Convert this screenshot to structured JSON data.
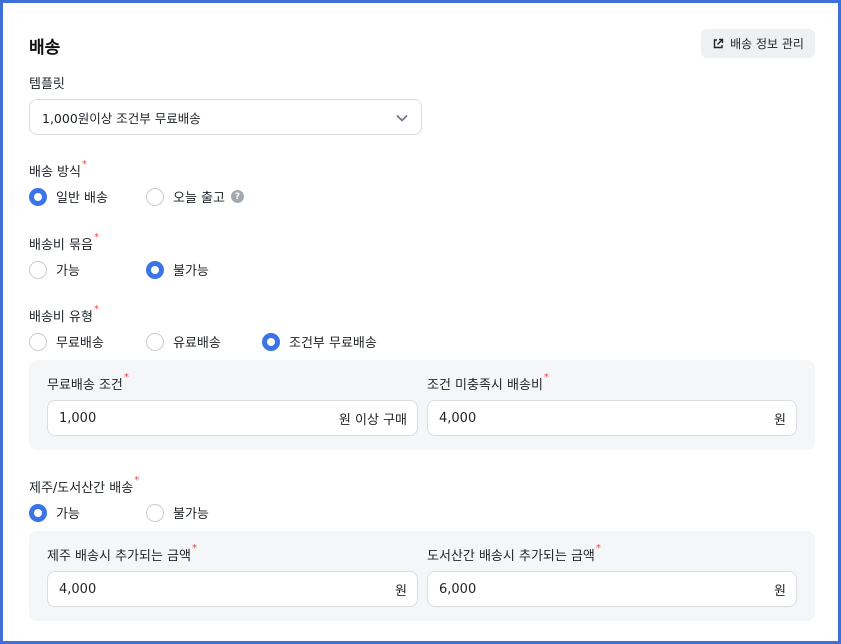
{
  "section": {
    "title": "배송",
    "manage_button_label": "배송 정보 관리"
  },
  "template": {
    "label": "템플릿",
    "selected": "1,000원이상 조건부 무료배송"
  },
  "shipping_method": {
    "label": "배송 방식",
    "required_mark": "*",
    "options": [
      {
        "label": "일반 배송",
        "selected": true
      },
      {
        "label": "오늘 출고",
        "selected": false
      }
    ],
    "help_glyph": "?"
  },
  "fee_bundle": {
    "label": "배송비 묶음",
    "required_mark": "*",
    "options": [
      {
        "label": "가능",
        "selected": false
      },
      {
        "label": "불가능",
        "selected": true
      }
    ]
  },
  "fee_type": {
    "label": "배송비 유형",
    "required_mark": "*",
    "options": [
      {
        "label": "무료배송",
        "selected": false
      },
      {
        "label": "유료배송",
        "selected": false
      },
      {
        "label": "조건부 무료배송",
        "selected": true
      }
    ],
    "free_condition": {
      "label": "무료배송 조건",
      "required_mark": "*",
      "value": "1,000",
      "suffix": "원 이상 구매"
    },
    "unmet_fee": {
      "label": "조건 미충족시 배송비",
      "required_mark": "*",
      "value": "4,000",
      "suffix": "원"
    }
  },
  "remote_shipping": {
    "label": "제주/도서산간 배송",
    "required_mark": "*",
    "options": [
      {
        "label": "가능",
        "selected": true
      },
      {
        "label": "불가능",
        "selected": false
      }
    ],
    "jeju_fee": {
      "label": "제주 배송시 추가되는 금액",
      "required_mark": "*",
      "value": "4,000",
      "suffix": "원"
    },
    "island_fee": {
      "label": "도서산간 배송시 추가되는 금액",
      "required_mark": "*",
      "value": "6,000",
      "suffix": "원"
    }
  },
  "colors": {
    "accent": "#3b74e6",
    "required": "#e5484d",
    "frame": "#3f6fd8",
    "panel_bg": "#f5f6f8"
  }
}
